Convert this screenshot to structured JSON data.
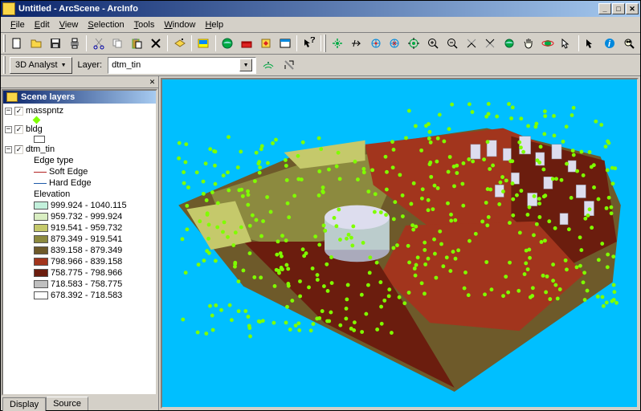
{
  "title": "Untitled - ArcScene - ArcInfo",
  "menu": {
    "file": "File",
    "edit": "Edit",
    "view": "View",
    "selection": "Selection",
    "tools": "Tools",
    "window": "Window",
    "help": "Help"
  },
  "analyst_label": "3D Analyst",
  "layer_label": "Layer:",
  "layer_value": "dtm_tin",
  "toc": {
    "title": "Scene layers",
    "layers": [
      {
        "name": "masspntz",
        "checked": true,
        "symbol_type": "point",
        "symbol_color": "#7fff00"
      },
      {
        "name": "bldg",
        "checked": true,
        "symbol_type": "fill",
        "symbol_color": "none"
      },
      {
        "name": "dtm_tin",
        "checked": true,
        "edge_heading": "Edge type",
        "edges": [
          {
            "label": "Soft Edge",
            "color": "#b22222"
          },
          {
            "label": "Hard Edge",
            "color": "#1e5aa8"
          }
        ],
        "elev_heading": "Elevation",
        "classes": [
          {
            "label": "999.924 - 1040.115",
            "color": "#c2f0db"
          },
          {
            "label": "959.732 - 999.924",
            "color": "#d9eec2"
          },
          {
            "label": "919.541 - 959.732",
            "color": "#c5c96b"
          },
          {
            "label": "879.349 - 919.541",
            "color": "#8c8a3f"
          },
          {
            "label": "839.158 - 879.349",
            "color": "#6e5a2a"
          },
          {
            "label": "798.966 - 839.158",
            "color": "#a2351d"
          },
          {
            "label": "758.775 - 798.966",
            "color": "#6b1d0e"
          },
          {
            "label": "718.583 - 758.775",
            "color": "#bfbfbf"
          },
          {
            "label": "678.392 - 718.583",
            "color": "#ffffff"
          }
        ]
      }
    ]
  },
  "tabs": {
    "display": "Display",
    "source": "Source"
  }
}
